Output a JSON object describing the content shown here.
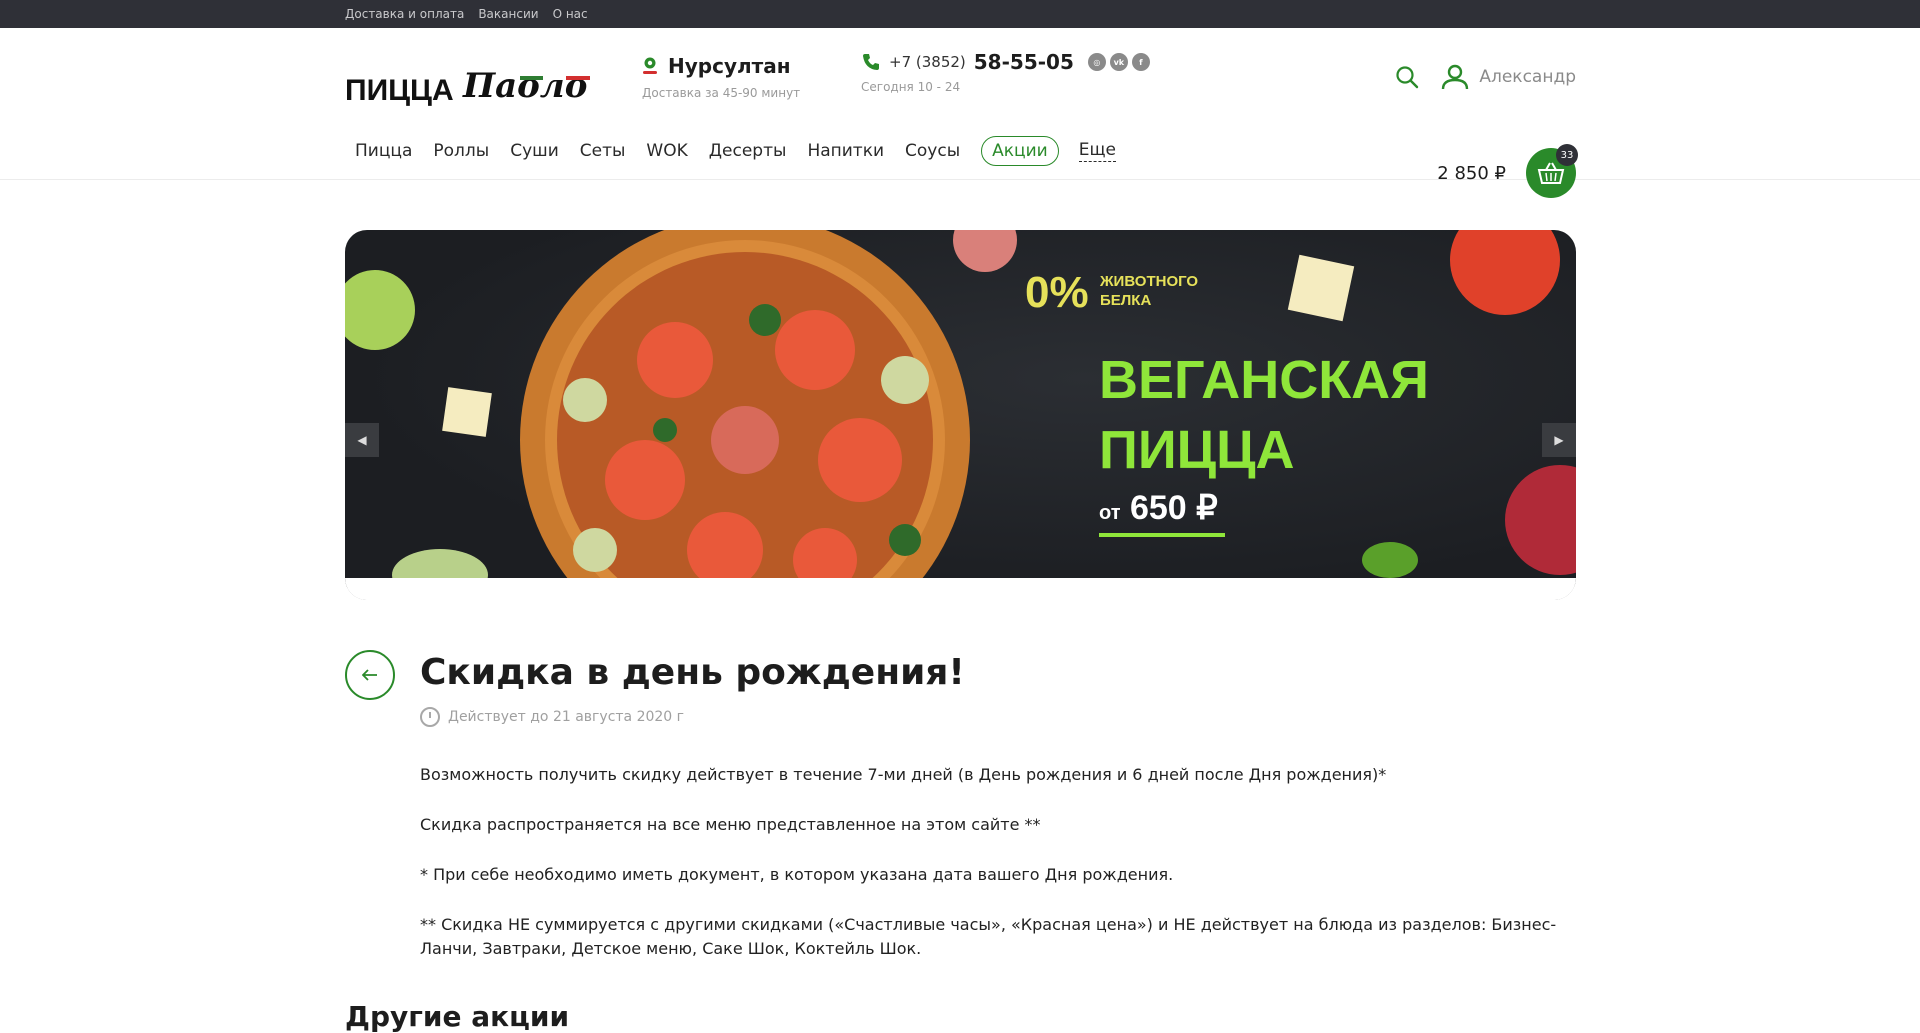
{
  "topbar": {
    "links": [
      "Доставка и оплата",
      "Вакансии",
      "О нас"
    ]
  },
  "header": {
    "logo": {
      "text_main": "ПИЦЦА",
      "text_script": "Паоло"
    },
    "city": {
      "name": "Нурсултан",
      "delivery": "Доставка за 45-90 минут"
    },
    "phone": {
      "prefix": "+7 (3852)",
      "number": "58-55-05",
      "hours": "Сегодня 10 - 24"
    },
    "social": [
      "instagram-icon",
      "vk-icon",
      "foursquare-icon"
    ],
    "user": {
      "name": "Александр"
    }
  },
  "nav": {
    "items": [
      "Пицца",
      "Роллы",
      "Суши",
      "Сеты",
      "WOK",
      "Десерты",
      "Напитки",
      "Соусы",
      "Акции",
      "Еще"
    ],
    "active": "Акции"
  },
  "cart": {
    "sum": "2 850 ₽",
    "count": "33"
  },
  "banner": {
    "percent": "0%",
    "percent_sub": "ЖИВОТНОГО БЕЛКА",
    "title": "ВЕГАНСКАЯ ПИЦЦА",
    "price_prefix": "от",
    "price": "650 ₽"
  },
  "article": {
    "title": "Скидка в день рождения!",
    "valid_until": "Действует до 21 августа 2020 г",
    "paragraphs": [
      "Возможность получить скидку действует в течение 7-ми дней (в День рождения и 6 дней после Дня рождения)*",
      "Скидка распространяется на все меню представленное на этом сайте **",
      "* При себе необходимо иметь документ, в котором указана дата вашего Дня рождения.",
      "** Скидка НЕ суммируется с другими скидками («Счастливые часы», «Красная цена») и НЕ действует на блюда из разделов: Бизнес-Ланчи, Завтраки, Детское меню, Саке Шок, Коктейль Шок."
    ]
  },
  "other_promos": {
    "title": "Другие акции"
  },
  "colors": {
    "accent": "#2a8a2a",
    "topbar": "#2f3037",
    "banner_green": "#8fe63a",
    "banner_yellow": "#e6e15a"
  }
}
